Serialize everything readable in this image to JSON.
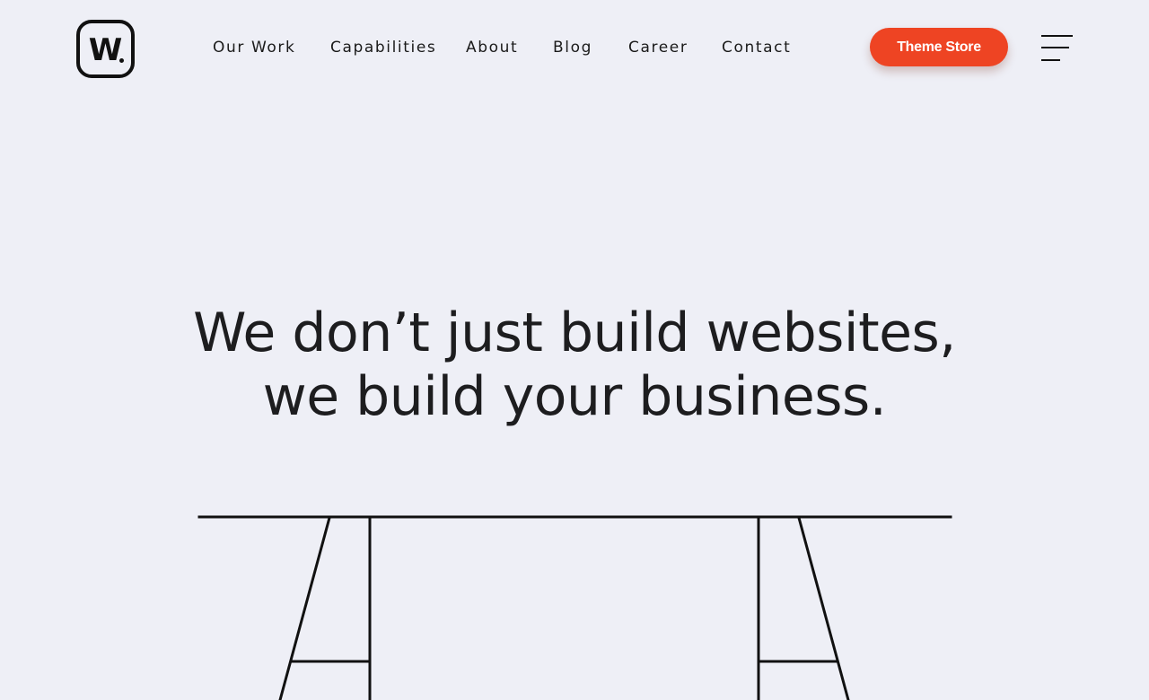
{
  "brand": {
    "logo_letter": "W",
    "accent_color": "#ee4423",
    "background_color": "#eeeff6"
  },
  "nav": {
    "items": [
      {
        "label": "Our Work"
      },
      {
        "label": "Capabilities"
      },
      {
        "label": "About"
      },
      {
        "label": "Blog"
      },
      {
        "label": "Career"
      },
      {
        "label": "Contact"
      }
    ]
  },
  "header": {
    "cta_label": "Theme Store",
    "menu_icon": "hamburger-menu-icon"
  },
  "hero": {
    "line1": "We don’t just build websites,",
    "line2": "we build your business."
  },
  "illustration": {
    "icon": "desk-illustration"
  }
}
